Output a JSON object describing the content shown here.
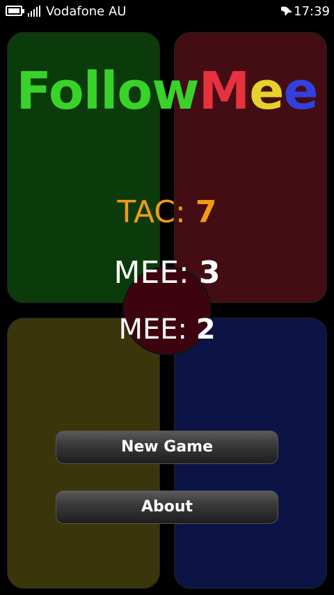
{
  "status_bar": {
    "carrier": "Vodafone AU",
    "time": "17:39",
    "icons": [
      "battery-icon",
      "signal-icon",
      "notification-icon"
    ]
  },
  "app": {
    "title_parts": [
      "Follow",
      "M",
      "e",
      "e"
    ],
    "colors": {
      "green": "#39d22b",
      "red": "#e8313f",
      "yellow": "#e6d22a",
      "blue": "#3340e0",
      "tac": "#f39a12"
    }
  },
  "scores": {
    "tac": {
      "label": "TAC:",
      "value": "7"
    },
    "mee1": {
      "label": "MEE:",
      "value": "3"
    },
    "mee2": {
      "label": "MEE:",
      "value": "2"
    }
  },
  "buttons": {
    "new_game": "New Game",
    "about": "About"
  }
}
